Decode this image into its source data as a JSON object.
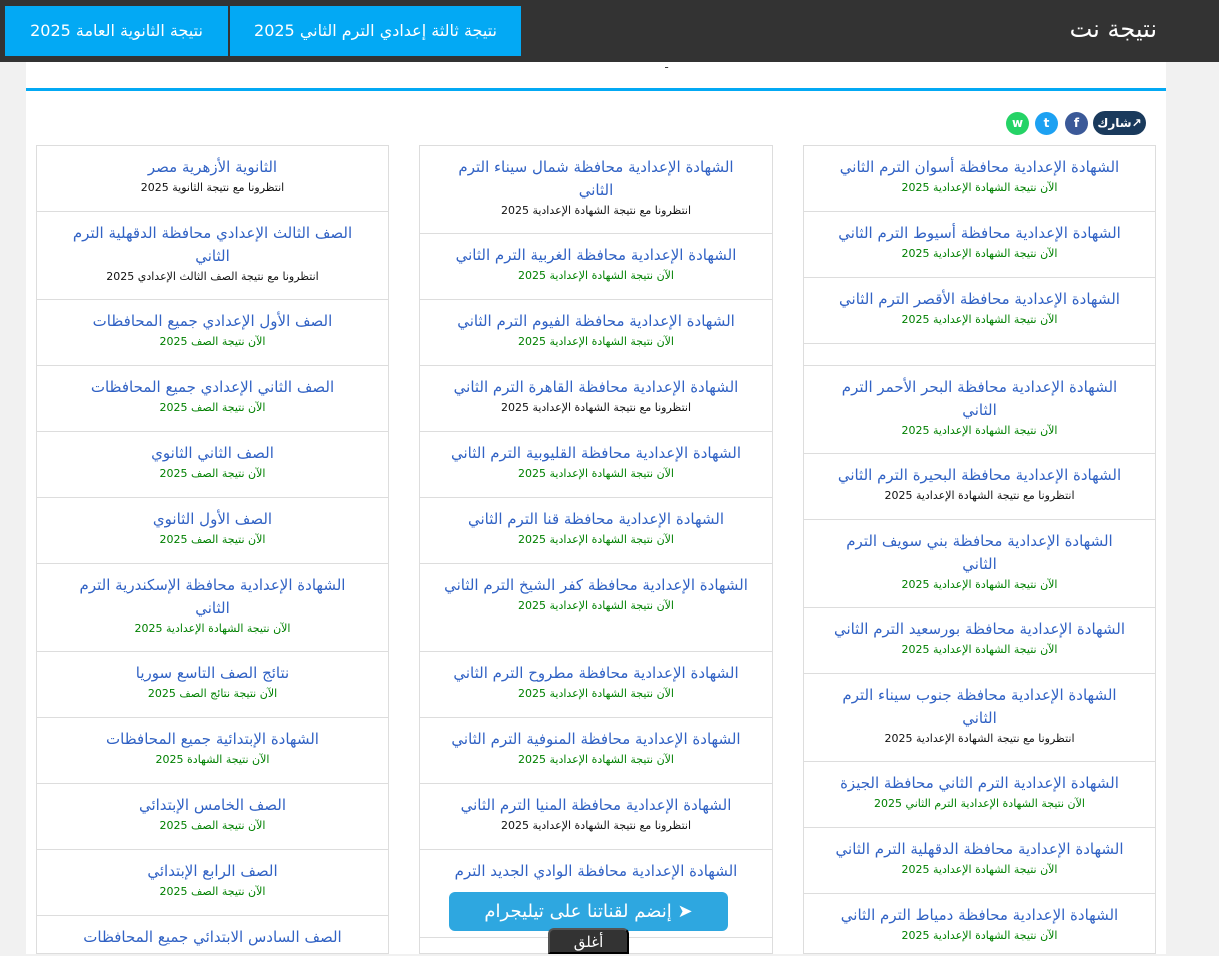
{
  "header": {
    "brand": "نتيجة نت",
    "nav": [
      "نتيجة ثالثة إعدادي الترم الثاني 2025",
      "نتيجة الثانوية العامة 2025"
    ]
  },
  "share": {
    "label": "شارك",
    "facebook": "f",
    "twitter": "t",
    "whatsapp": "w"
  },
  "columns": [
    {
      "items": [
        {
          "title": "الشهادة الإعدادية محافظة أسوان الترم الثاني",
          "status": "الآن نتيجة الشهادة الإعدادية 2025",
          "status_color": "green"
        },
        {
          "title": "الشهادة الإعدادية محافظة أسيوط الترم الثاني",
          "status": "الآن نتيجة الشهادة الإعدادية 2025",
          "status_color": "green"
        },
        {
          "title": "الشهادة الإعدادية محافظة الأقصر الترم الثاني",
          "status": "الآن نتيجة الشهادة الإعدادية 2025",
          "status_color": "green"
        },
        {
          "title": "",
          "status": "",
          "status_color": "green"
        },
        {
          "title": "الشهادة الإعدادية محافظة البحر الأحمر الترم الثاني",
          "status": "الآن نتيجة الشهادة الإعدادية 2025",
          "status_color": "green"
        },
        {
          "title": "الشهادة الإعدادية محافظة البحيرة الترم الثاني",
          "status": "انتظرونا مع نتيجة الشهادة الإعدادية 2025",
          "status_color": "black"
        },
        {
          "title": "الشهادة الإعدادية محافظة بني سويف الترم الثاني",
          "status": "الآن نتيجة الشهادة الإعدادية 2025",
          "status_color": "green"
        },
        {
          "title": "الشهادة الإعدادية محافظة بورسعيد الترم الثاني",
          "status": "الآن نتيجة الشهادة الإعدادية 2025",
          "status_color": "green"
        },
        {
          "title": "الشهادة الإعدادية محافظة جنوب سيناء الترم الثاني",
          "status": "انتظرونا مع نتيجة الشهادة الإعدادية 2025",
          "status_color": "black"
        },
        {
          "title": "الشهادة الإعدادية الترم الثاني محافظة الجيزة",
          "status": "الآن نتيجة الشهادة الإعدادية الترم الثاني 2025",
          "status_color": "green"
        },
        {
          "title": "الشهادة الإعدادية محافظة الدقهلية الترم الثاني",
          "status": "الآن نتيجة الشهادة الإعدادية 2025",
          "status_color": "green"
        },
        {
          "title": "الشهادة الإعدادية محافظة دمياط الترم الثاني",
          "status": "الآن نتيجة الشهادة الإعدادية 2025",
          "status_color": "green"
        }
      ]
    },
    {
      "items": [
        {
          "title": "الشهادة الإعدادية محافظة شمال سيناء الترم الثاني",
          "status": "انتظرونا مع نتيجة الشهادة الإعدادية 2025",
          "status_color": "black"
        },
        {
          "title": "الشهادة الإعدادية محافظة الغربية الترم الثاني",
          "status": "الآن نتيجة الشهادة الإعدادية 2025",
          "status_color": "green"
        },
        {
          "title": "الشهادة الإعدادية محافظة الفيوم الترم الثاني",
          "status": "الآن نتيجة الشهادة الإعدادية 2025",
          "status_color": "green"
        },
        {
          "title": "الشهادة الإعدادية محافظة القاهرة الترم الثاني",
          "status": "انتظرونا مع نتيجة الشهادة الإعدادية 2025",
          "status_color": "black"
        },
        {
          "title": "الشهادة الإعدادية محافظة القليوبية الترم الثاني",
          "status": "الآن نتيجة الشهادة الإعدادية 2025",
          "status_color": "green"
        },
        {
          "title": "الشهادة الإعدادية محافظة قنا الترم الثاني",
          "status": "الآن نتيجة الشهادة الإعدادية 2025",
          "status_color": "green"
        },
        {
          "title": "الشهادة الإعدادية محافظة كفر الشيخ الترم الثاني",
          "status": "الآن نتيجة الشهادة الإعدادية 2025",
          "status_color": "green"
        },
        {
          "title": "الشهادة الإعدادية محافظة مطروح الترم الثاني",
          "status": "الآن نتيجة الشهادة الإعدادية 2025",
          "status_color": "green"
        },
        {
          "title": "الشهادة الإعدادية محافظة المنوفية الترم الثاني",
          "status": "الآن نتيجة الشهادة الإعدادية 2025",
          "status_color": "green"
        },
        {
          "title": "الشهادة الإعدادية محافظة المنيا الترم الثاني",
          "status": "انتظرونا مع نتيجة الشهادة الإعدادية 2025",
          "status_color": "black"
        },
        {
          "title": "الشهادة الإعدادية محافظة الوادي الجديد الترم",
          "status": "",
          "status_color": "green"
        }
      ]
    },
    {
      "items": [
        {
          "title": "الثانوية الأزهرية مصر",
          "status": "انتظرونا مع نتيجة الثانوية 2025",
          "status_color": "black"
        },
        {
          "title": "الصف الثالث الإعدادي محافظة الدقهلية الترم الثاني",
          "status": "انتظرونا مع نتيجة الصف الثالث الإعدادي 2025",
          "status_color": "black"
        },
        {
          "title": "الصف الأول الإعدادي جميع المحافظات",
          "status": "الآن نتيجة الصف 2025",
          "status_color": "green"
        },
        {
          "title": "الصف الثاني الإعدادي جميع المحافظات",
          "status": "الآن نتيجة الصف 2025",
          "status_color": "green"
        },
        {
          "title": "الصف الثاني الثانوي",
          "status": "الآن نتيجة الصف 2025",
          "status_color": "green"
        },
        {
          "title": "الصف الأول الثانوي",
          "status": "الآن نتيجة الصف 2025",
          "status_color": "green"
        },
        {
          "title": "الشهادة الإعدادية محافظة الإسكندرية الترم الثاني",
          "status": "الآن نتيجة الشهادة الإعدادية 2025",
          "status_color": "green"
        },
        {
          "title": "نتائج الصف التاسع سوريا",
          "status": "الآن نتيجة نتائج الصف 2025",
          "status_color": "green"
        },
        {
          "title": "الشهادة الإبتدائية جميع المحافظات",
          "status": "الآن نتيجة الشهادة 2025",
          "status_color": "green"
        },
        {
          "title": "الصف الخامس الإبتدائي",
          "status": "الآن نتيجة الصف 2025",
          "status_color": "green"
        },
        {
          "title": "الصف الرابع الإبتدائي",
          "status": "الآن نتيجة الصف 2025",
          "status_color": "green"
        },
        {
          "title": "الصف السادس الابتدائي جميع المحافظات",
          "status": "",
          "status_color": "green"
        }
      ]
    }
  ],
  "telegram": {
    "label": "إنضم لقناتنا على تيليجرام"
  },
  "close": {
    "label": "أغلق"
  }
}
